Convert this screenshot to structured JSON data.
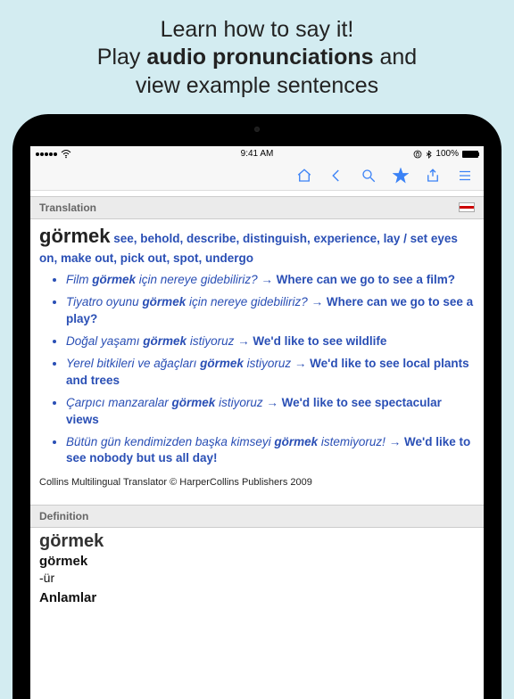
{
  "promo": {
    "line1": "Learn how to say it!",
    "line2a": "Play ",
    "line2b": "audio pronunciations",
    "line2c": " and",
    "line3": "view example sentences"
  },
  "status": {
    "carrier": "",
    "time": "9:41 AM",
    "battery": "100%"
  },
  "sections": {
    "translation_label": "Translation",
    "definition_label": "Definition"
  },
  "entry": {
    "headword": "görmek",
    "translations": "see, behold, describe, distinguish, experience, lay / set eyes on, make out, pick out, spot, undergo",
    "examples": [
      {
        "src_pre": "Film ",
        "kw": "görmek",
        "src_post": " için nereye gidebiliriz?",
        "tgt": "Where can we go to see a film?"
      },
      {
        "src_pre": "Tiyatro oyunu ",
        "kw": "görmek",
        "src_post": " için nereye gidebiliriz?",
        "tgt": "Where can we go to see a play?"
      },
      {
        "src_pre": "Doğal yaşamı ",
        "kw": "görmek",
        "src_post": " istiyoruz",
        "tgt": "We'd like to see wildlife"
      },
      {
        "src_pre": "Yerel bitkileri ve ağaçları ",
        "kw": "görmek",
        "src_post": " istiyoruz",
        "tgt": "We'd like to see local plants and trees"
      },
      {
        "src_pre": "Çarpıcı manzaralar ",
        "kw": "görmek",
        "src_post": " istiyoruz",
        "tgt": "We'd like to see spectacular views"
      },
      {
        "src_pre": "Bütün gün kendimizden başka kimseyi ",
        "kw": "görmek",
        "src_post": " istemiyoruz!",
        "tgt": "We'd like to see nobody but us all day!"
      }
    ],
    "copyright": "Collins Multilingual Translator © HarperCollins Publishers 2009"
  },
  "definition": {
    "headword": "görmek",
    "sub": "görmek",
    "line1": "-ür",
    "line2": "Anlamlar"
  },
  "arrow": "→"
}
